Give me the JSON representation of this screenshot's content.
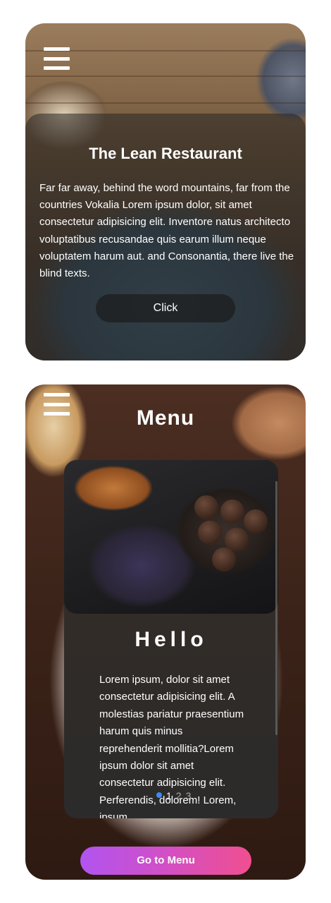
{
  "hero": {
    "title": "The Lean Restaurant",
    "body": "Far far away, behind the word mountains, far from the countries Vokalia Lorem ipsum dolor, sit amet consectetur adipisicing elit. Inventore natus architecto voluptatibus recusandae quis earum illum neque voluptatem harum aut. and Consonantia, there live the blind texts.",
    "button_label": "Click",
    "menu_icon": "hamburger-menu-icon"
  },
  "menu": {
    "title": "Menu",
    "menu_icon": "hamburger-menu-icon",
    "slide": {
      "heading": "Hello",
      "body": "Lorem ipsum, dolor sit amet consectetur adipisicing elit. A molestias pariatur praesentium harum quis minus reprehenderit mollitia?Lorem ipsum dolor sit amet consectetur adipisicing elit. Perferendis, dolorem! Lorem, ipsum"
    },
    "pagination": {
      "pages": [
        "1",
        "2",
        "3"
      ],
      "active": "1"
    },
    "cta_label": "Go to Menu"
  },
  "colors": {
    "cta_gradient_start": "#b154f0",
    "cta_gradient_end": "#f04f8f",
    "pager_active_dot": "#3d8bf0"
  }
}
